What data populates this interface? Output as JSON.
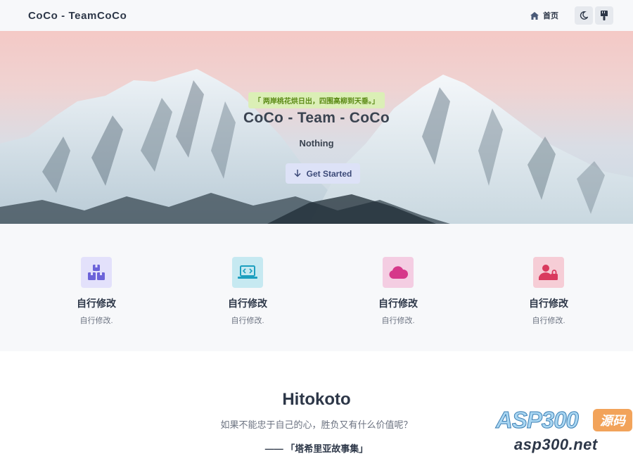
{
  "header": {
    "brand": "CoCo - TeamCoCo",
    "nav_home": "首页",
    "icons": [
      "home-icon",
      "moon-icon",
      "palette-icon"
    ]
  },
  "hero": {
    "poem": "「 两岸桃花烘日出，四围高柳到天垂。」",
    "title": "CoCo - Team - CoCo",
    "subtitle": "Nothing",
    "cta_label": "Get Started",
    "cta_icon": "arrow-down-icon"
  },
  "features": [
    {
      "icon": "boxes-icon",
      "title": "自行修改",
      "desc": "自行修改.",
      "color": "#6c63d9",
      "bg": "#e3e1fb"
    },
    {
      "icon": "laptop-code-icon",
      "title": "自行修改",
      "desc": "自行修改.",
      "color": "#1c9fbf",
      "bg": "#c6e9f1"
    },
    {
      "icon": "cloud-icon",
      "title": "自行修改",
      "desc": "自行修改.",
      "color": "#d6388a",
      "bg": "#f4cde2"
    },
    {
      "icon": "user-lock-icon",
      "title": "自行修改",
      "desc": "自行修改.",
      "color": "#d93a5e",
      "bg": "#f6cdd6"
    }
  ],
  "hitokoto": {
    "title": "Hitokoto",
    "quote": "如果不能忠于自己的心，胜负又有什么价值呢？",
    "source": "—— 「塔希里亚故事集」"
  },
  "watermark": {
    "logo": "ASP300",
    "badge": "源码",
    "url": "asp300.net"
  }
}
